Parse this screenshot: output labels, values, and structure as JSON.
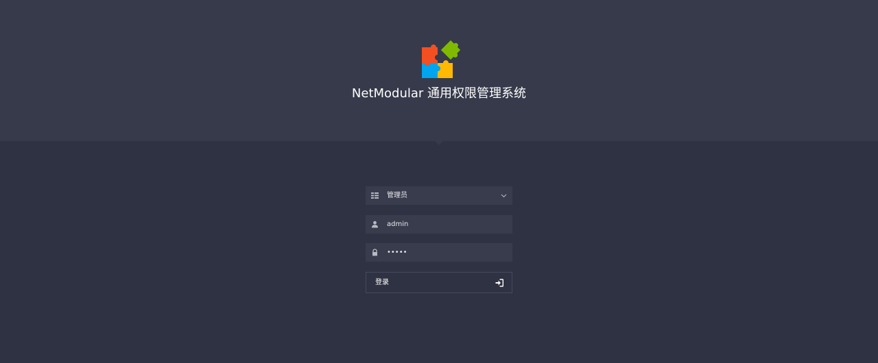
{
  "app": {
    "title": "NetModular 通用权限管理系统",
    "logo_icon": "puzzle-logo-icon"
  },
  "form": {
    "account_type": {
      "icon": "account-type-icon",
      "selected": "管理员"
    },
    "username": {
      "icon": "user-icon",
      "value": "admin"
    },
    "password": {
      "icon": "lock-icon",
      "value": "•••••"
    },
    "login_button": {
      "label": "登录",
      "icon": "sign-in-icon"
    }
  },
  "colors": {
    "header_bg": "#363a4a",
    "page_bg": "#2f3242",
    "field_bg": "#393c4c",
    "logo_red": "#f25022",
    "logo_green": "#7fba00",
    "logo_blue": "#00a4ef",
    "logo_yellow": "#ffb900"
  }
}
